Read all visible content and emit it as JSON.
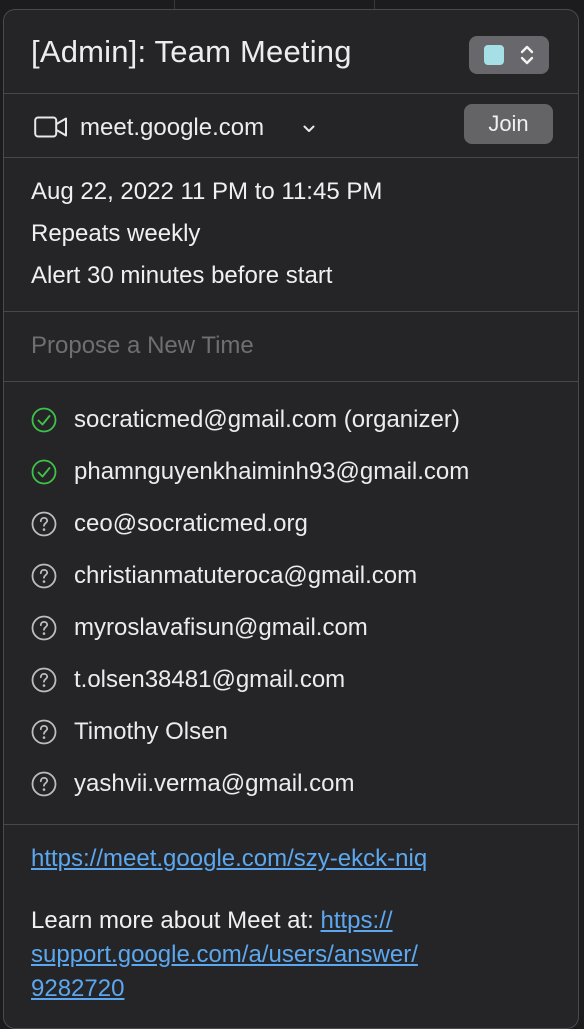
{
  "event": {
    "title": "[Admin]: Team Meeting",
    "calendar_color": "#a6e0e6"
  },
  "video": {
    "icon": "video-camera-icon",
    "url": "meet.google.com",
    "join_label": "Join"
  },
  "time": {
    "when": "Aug 22, 2022  11 PM to 11:45 PM",
    "repeat": "Repeats weekly",
    "alert": "Alert 30 minutes before start"
  },
  "propose_label": "Propose a New Time",
  "attendees": [
    {
      "text": "socraticmed@gmail.com (organizer)",
      "status": "accepted"
    },
    {
      "text": "phamnguyenkhaiminh93@gmail.com",
      "status": "accepted"
    },
    {
      "text": "ceo@socraticmed.org",
      "status": "unknown"
    },
    {
      "text": "christianmatuteroca@gmail.com",
      "status": "unknown"
    },
    {
      "text": "myroslavafisun@gmail.com",
      "status": "unknown"
    },
    {
      "text": "t.olsen38481@gmail.com",
      "status": "unknown"
    },
    {
      "text": "Timothy Olsen",
      "status": "unknown"
    },
    {
      "text": "yashvii.verma@gmail.com",
      "status": "unknown"
    }
  ],
  "status_colors": {
    "accepted": "#3ec24a",
    "unknown": "#bdbdbd"
  },
  "notes": {
    "meet_link": "https://meet.google.com/szy-ekck-niq",
    "learn_prefix": "Learn more about Meet at: ",
    "support_link_line1": "https://",
    "support_link_line2": "support.google.com/a/users/answer/",
    "support_link_line3": "9282720"
  }
}
